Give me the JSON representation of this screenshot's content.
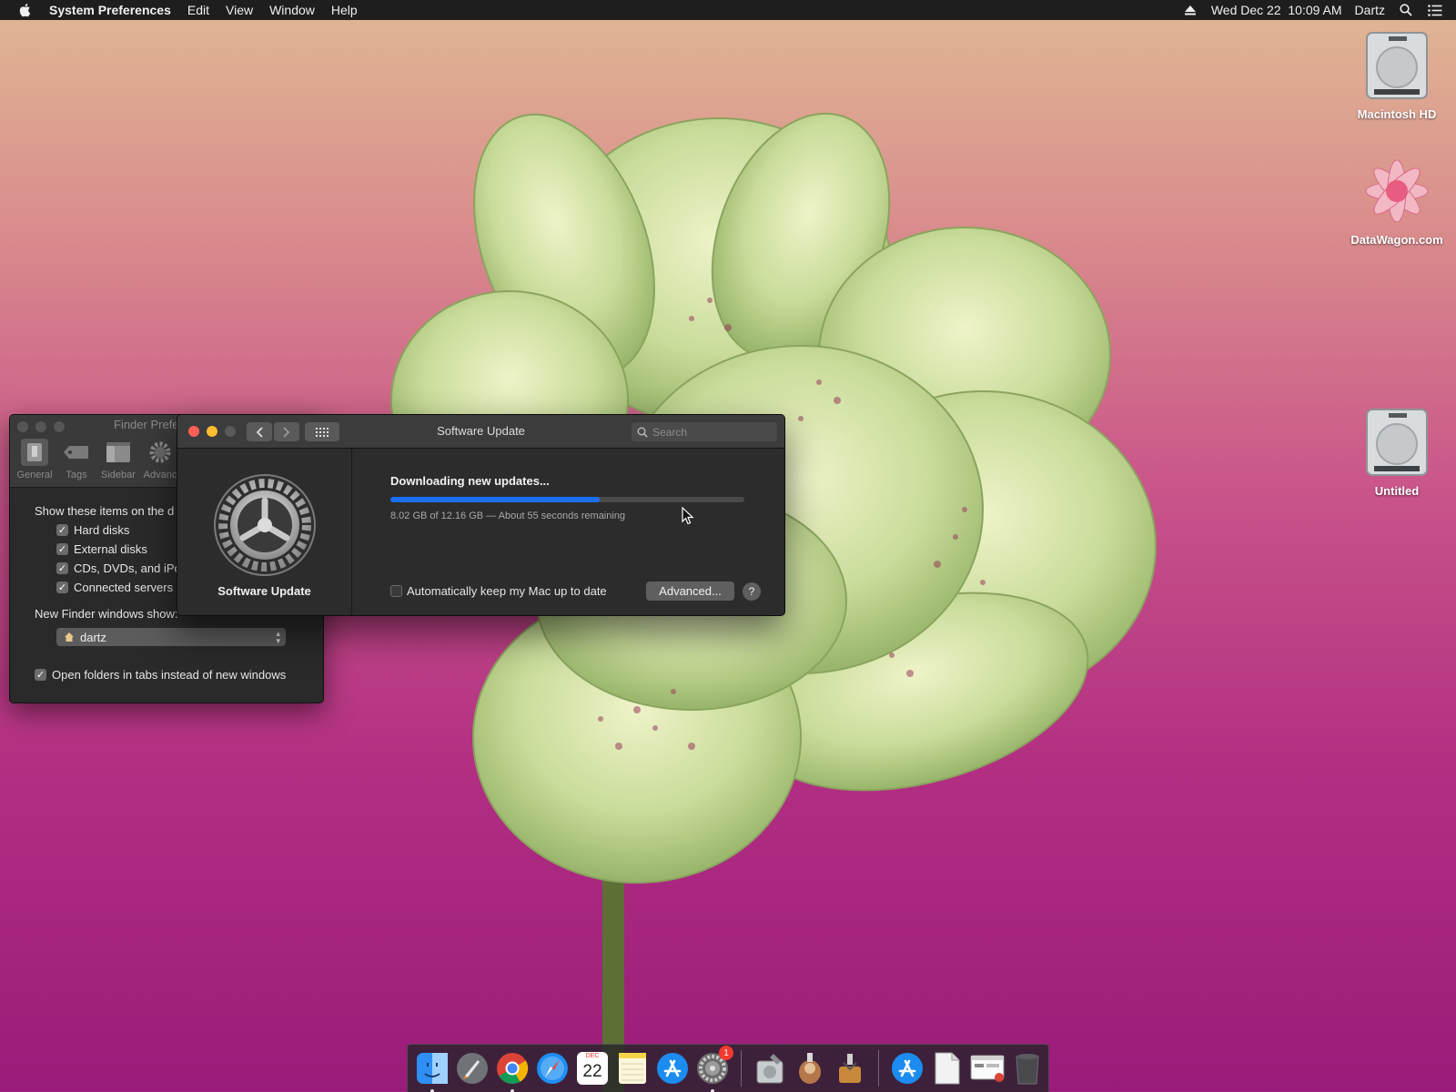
{
  "menubar": {
    "app_name": "System Preferences",
    "items": [
      "Edit",
      "View",
      "Window",
      "Help"
    ],
    "datetime": "Wed Dec 22  10:09 AM",
    "user": "Dartz",
    "icons": [
      "apple-icon",
      "eject-icon",
      "spotlight-search-icon",
      "notification-center-icon"
    ]
  },
  "desktop": {
    "icons": [
      {
        "label": "Macintosh HD",
        "icon": "hard-drive-icon"
      },
      {
        "label": "DataWagon.com",
        "icon": "flower-image-icon"
      },
      {
        "label": "Untitled",
        "icon": "hard-drive-icon"
      }
    ]
  },
  "finder_prefs": {
    "title": "Finder Prefe",
    "tabs": [
      {
        "label": "General",
        "icon": "general-icon",
        "active": true
      },
      {
        "label": "Tags",
        "icon": "tag-icon",
        "active": false
      },
      {
        "label": "Sidebar",
        "icon": "sidebar-icon",
        "active": false
      },
      {
        "label": "Advanc",
        "icon": "gear-icon",
        "active": false
      }
    ],
    "show_items_label": "Show these items on the d",
    "checkboxes": [
      {
        "label": "Hard disks",
        "checked": true
      },
      {
        "label": "External disks",
        "checked": true
      },
      {
        "label": "CDs, DVDs, and iPo",
        "checked": true
      },
      {
        "label": "Connected servers",
        "checked": true
      }
    ],
    "new_windows_label": "New Finder windows show:",
    "new_windows_value": "dartz",
    "open_folders_tabs": {
      "label": "Open folders in tabs instead of new windows",
      "checked": true
    }
  },
  "software_update": {
    "window_title": "Software Update",
    "search_placeholder": "Search",
    "pane_label": "Software Update",
    "status_title": "Downloading new updates...",
    "progress_fraction": 0.59,
    "progress_text": "8.02 GB of 12.16 GB — About 55 seconds remaining",
    "auto_update_label": "Automatically keep my Mac up to date",
    "auto_update_checked": false,
    "advanced_label": "Advanced...",
    "help_label": "?"
  },
  "dock": {
    "calendar_month": "DEC",
    "calendar_day": "22",
    "sysprefs_badge": "1",
    "items": [
      "finder-icon",
      "launchpad-icon",
      "chrome-icon",
      "safari-icon",
      "calendar-icon",
      "notes-icon",
      "app-store-icon",
      "system-preferences-icon",
      "disk-utility-icon",
      "installer-icon",
      "installer-icon-2",
      "app-store-icon-2",
      "document-icon",
      "browser-window-icon",
      "trash-icon"
    ]
  },
  "colors": {
    "accent_blue": "#1d6ff2",
    "close_red": "#ff5f57",
    "minimize_yellow": "#febc2e"
  }
}
